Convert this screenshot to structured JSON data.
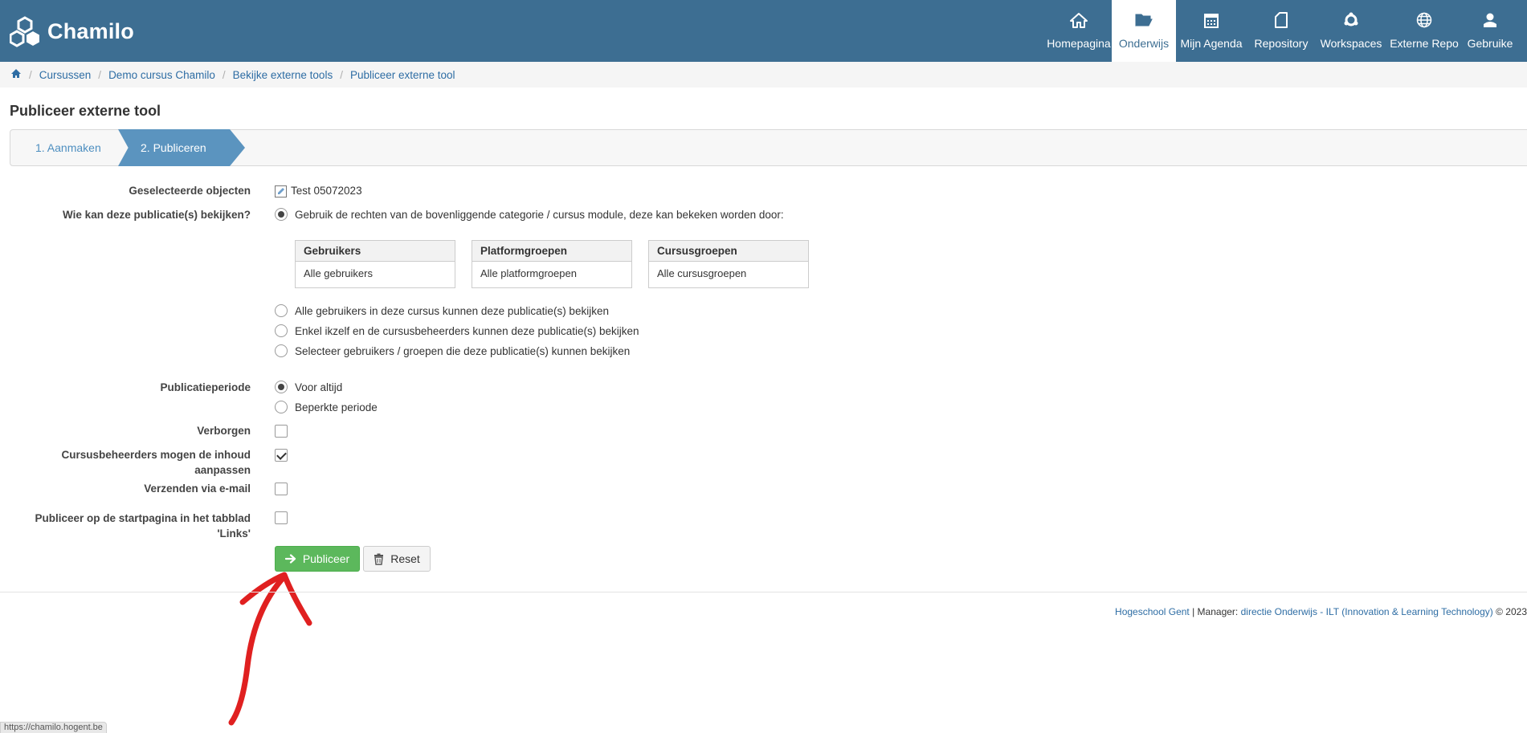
{
  "app": {
    "name": "Chamilo"
  },
  "nav": [
    {
      "label": "Homepagina",
      "icon": "home-icon",
      "active": false
    },
    {
      "label": "Onderwijs",
      "icon": "folder-open-icon",
      "active": true
    },
    {
      "label": "Mijn Agenda",
      "icon": "calendar-icon",
      "active": false
    },
    {
      "label": "Repository",
      "icon": "file-icon",
      "active": false
    },
    {
      "label": "Workspaces",
      "icon": "share-icon",
      "active": false
    },
    {
      "label": "Externe Repo",
      "icon": "globe-icon",
      "active": false
    },
    {
      "label": "Gebruike",
      "icon": "user-icon",
      "active": false
    }
  ],
  "breadcrumb": [
    "Cursussen",
    "Demo cursus Chamilo",
    "Bekijke externe tools",
    "Publiceer externe tool"
  ],
  "page": {
    "title": "Publiceer externe tool"
  },
  "wizard": {
    "steps": [
      "1. Aanmaken",
      "2. Publiceren"
    ],
    "active_step": 2
  },
  "form": {
    "selected_label": "Geselecteerde objecten",
    "selected_value": "Test 05072023",
    "who_label": "Wie kan deze publicatie(s) bekijken?",
    "who_options": [
      "Gebruik de rechten van de bovenliggende categorie / cursus module, deze kan bekeken worden door:",
      "Alle gebruikers in deze cursus kunnen deze publicatie(s) bekijken",
      "Enkel ikzelf en de cursusbeheerders kunnen deze publicatie(s) bekijken",
      "Selecteer gebruikers / groepen die deze publicatie(s) kunnen bekijken"
    ],
    "who_selected": 0,
    "rights_tables": [
      {
        "header": "Gebruikers",
        "value": "Alle gebruikers"
      },
      {
        "header": "Platformgroepen",
        "value": "Alle platformgroepen"
      },
      {
        "header": "Cursusgroepen",
        "value": "Alle cursusgroepen"
      }
    ],
    "period_label": "Publicatieperiode",
    "period_options": [
      "Voor altijd",
      "Beperkte periode"
    ],
    "period_selected": 0,
    "hidden_label": "Verborgen",
    "hidden_checked": false,
    "editors_label_line1": "Cursusbeheerders mogen de inhoud",
    "editors_label_line2": "aanpassen",
    "editors_checked": true,
    "email_label": "Verzenden via e-mail",
    "email_checked": false,
    "home_label_line1": "Publiceer op de startpagina in het tabblad",
    "home_label_line2": "'Links'",
    "home_checked": false,
    "publish_button": "Publiceer",
    "reset_button": "Reset"
  },
  "footer": {
    "org": "Hogeschool Gent",
    "manager_prefix": "| Manager:",
    "manager": "directie Onderwijs - ILT (Innovation & Learning Technology)",
    "copyright": "© 2023"
  },
  "status_url": "https://chamilo.hogent.be",
  "colors": {
    "header": "#3d6e92",
    "wizard_active": "#5b94bf",
    "publish": "#5cb85c",
    "link": "#2e6da4",
    "annotation_arrow": "#e02020"
  }
}
